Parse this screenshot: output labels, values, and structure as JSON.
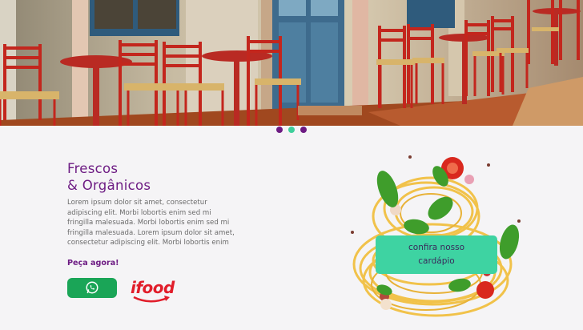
{
  "hero": {
    "image": "cafe-terrace-red-chairs",
    "carousel_dots": 3,
    "active_dot": 2
  },
  "content": {
    "title_line1": "Frescos",
    "title_line2": "& Orgânicos",
    "description": "Lorem ipsum dolor sit amet, consectetur adipiscing elit. Morbi lobortis enim sed mi fringilla malesuada. Morbi lobortis enim sed mi fringilla malesuada. Lorem ipsum dolor sit amet, consectetur adipiscing elit. Morbi lobortis enim",
    "order_label": "Peça agora!",
    "whatsapp_icon": "whatsapp-icon",
    "ifood_logo": "ifood"
  },
  "menu_button": {
    "line1": "confira nosso",
    "line2": "cardápio"
  },
  "colors": {
    "brand_purple": "#6d1b83",
    "accent_green": "#3ed3a2",
    "whatsapp_green": "#1aa557",
    "ifood_red": "#e11d2a",
    "background": "#f5f4f6"
  }
}
